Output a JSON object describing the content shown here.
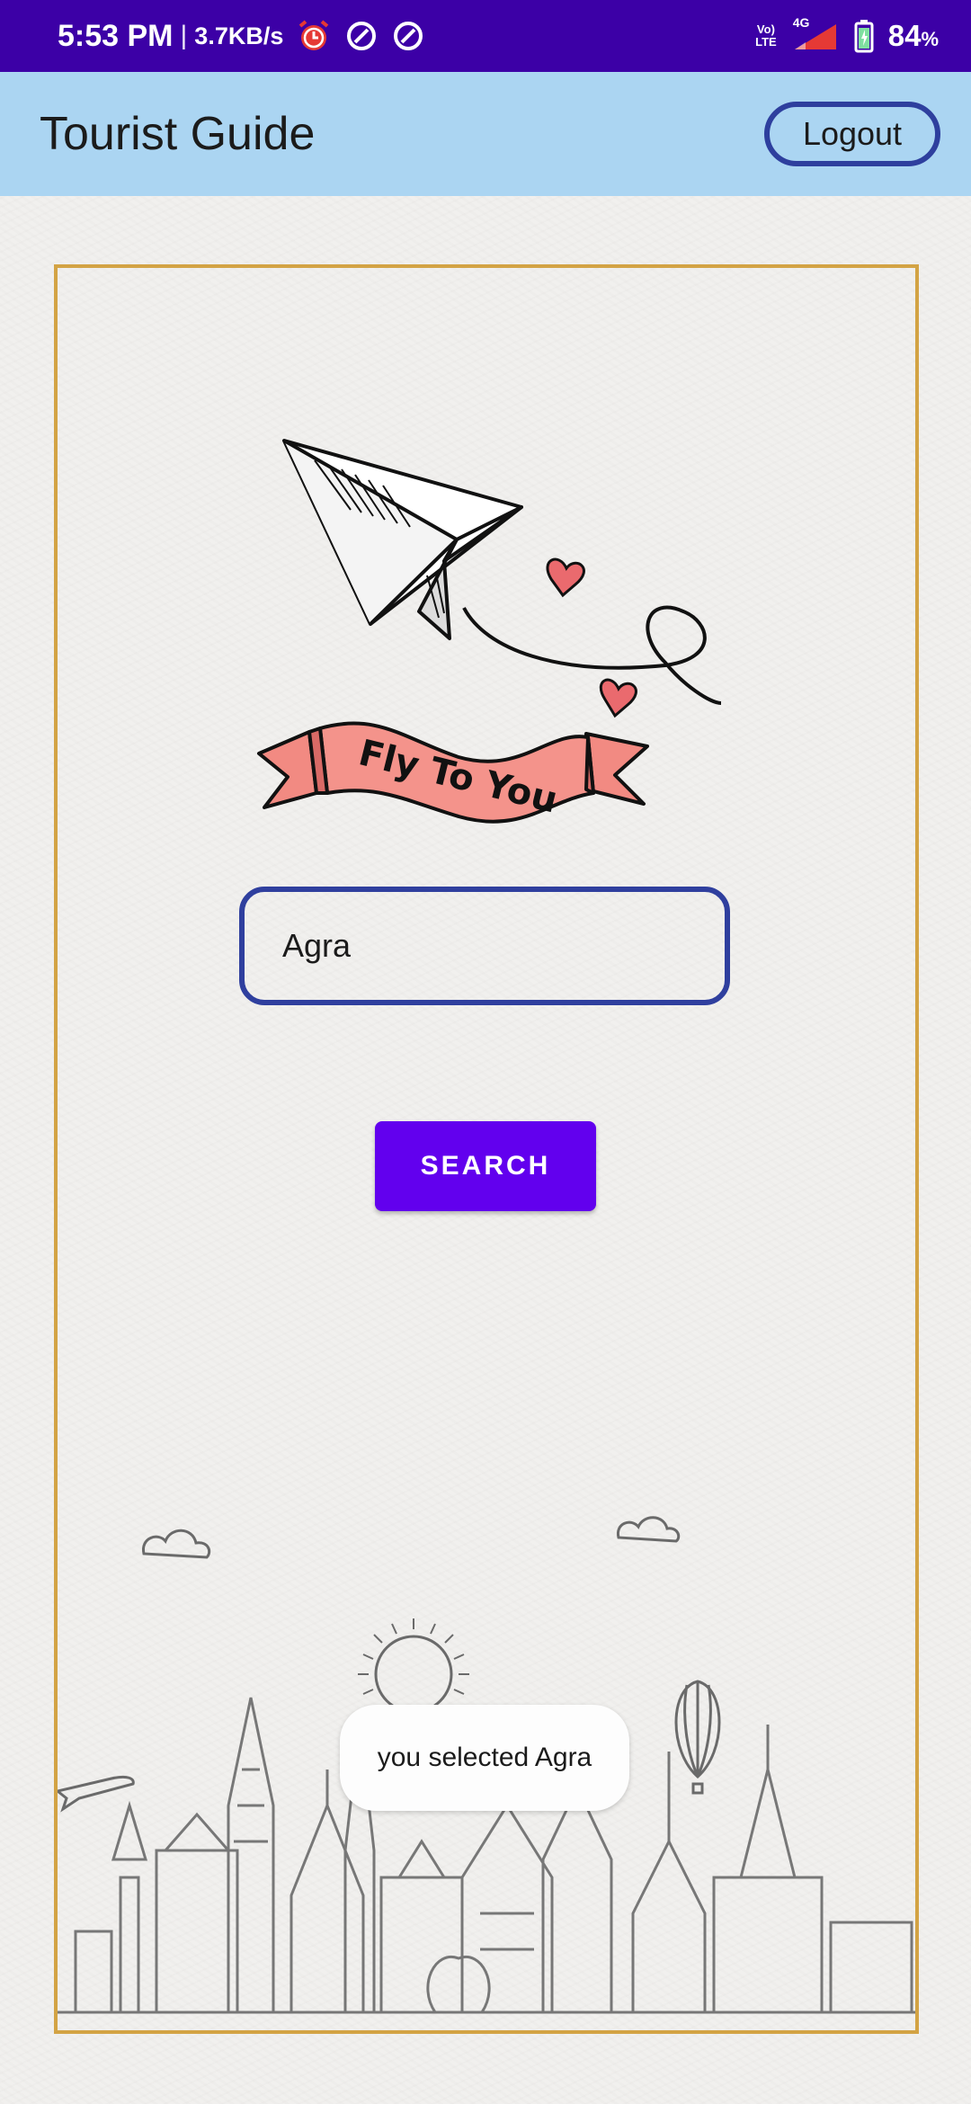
{
  "status_bar": {
    "time": "5:53 PM",
    "separator": "|",
    "net_speed": "3.7KB/s",
    "volte_top": "Vo)",
    "volte_bottom": "LTE",
    "network": "4G",
    "battery": "84",
    "battery_unit": "%",
    "icons": [
      "alarm-icon",
      "data-saver-icon",
      "data-saver-icon",
      "volte-icon",
      "signal-icon",
      "battery-icon"
    ],
    "colors": {
      "background": "#3c00a6",
      "alarm": "#e53935"
    }
  },
  "app_bar": {
    "title": "Tourist Guide",
    "logout_label": "Logout",
    "colors": {
      "background": "#abd5f2",
      "outline": "#2e3f9e"
    }
  },
  "main": {
    "banner_text": "Fly To You",
    "search_value": "Agra",
    "search_button_label": "SEARCH",
    "colors": {
      "frame": "#d3a344",
      "button": "#6200ee",
      "ribbon": "#f28a82",
      "heart": "#ea6a6e"
    }
  },
  "toast": {
    "message": "you selected Agra"
  }
}
